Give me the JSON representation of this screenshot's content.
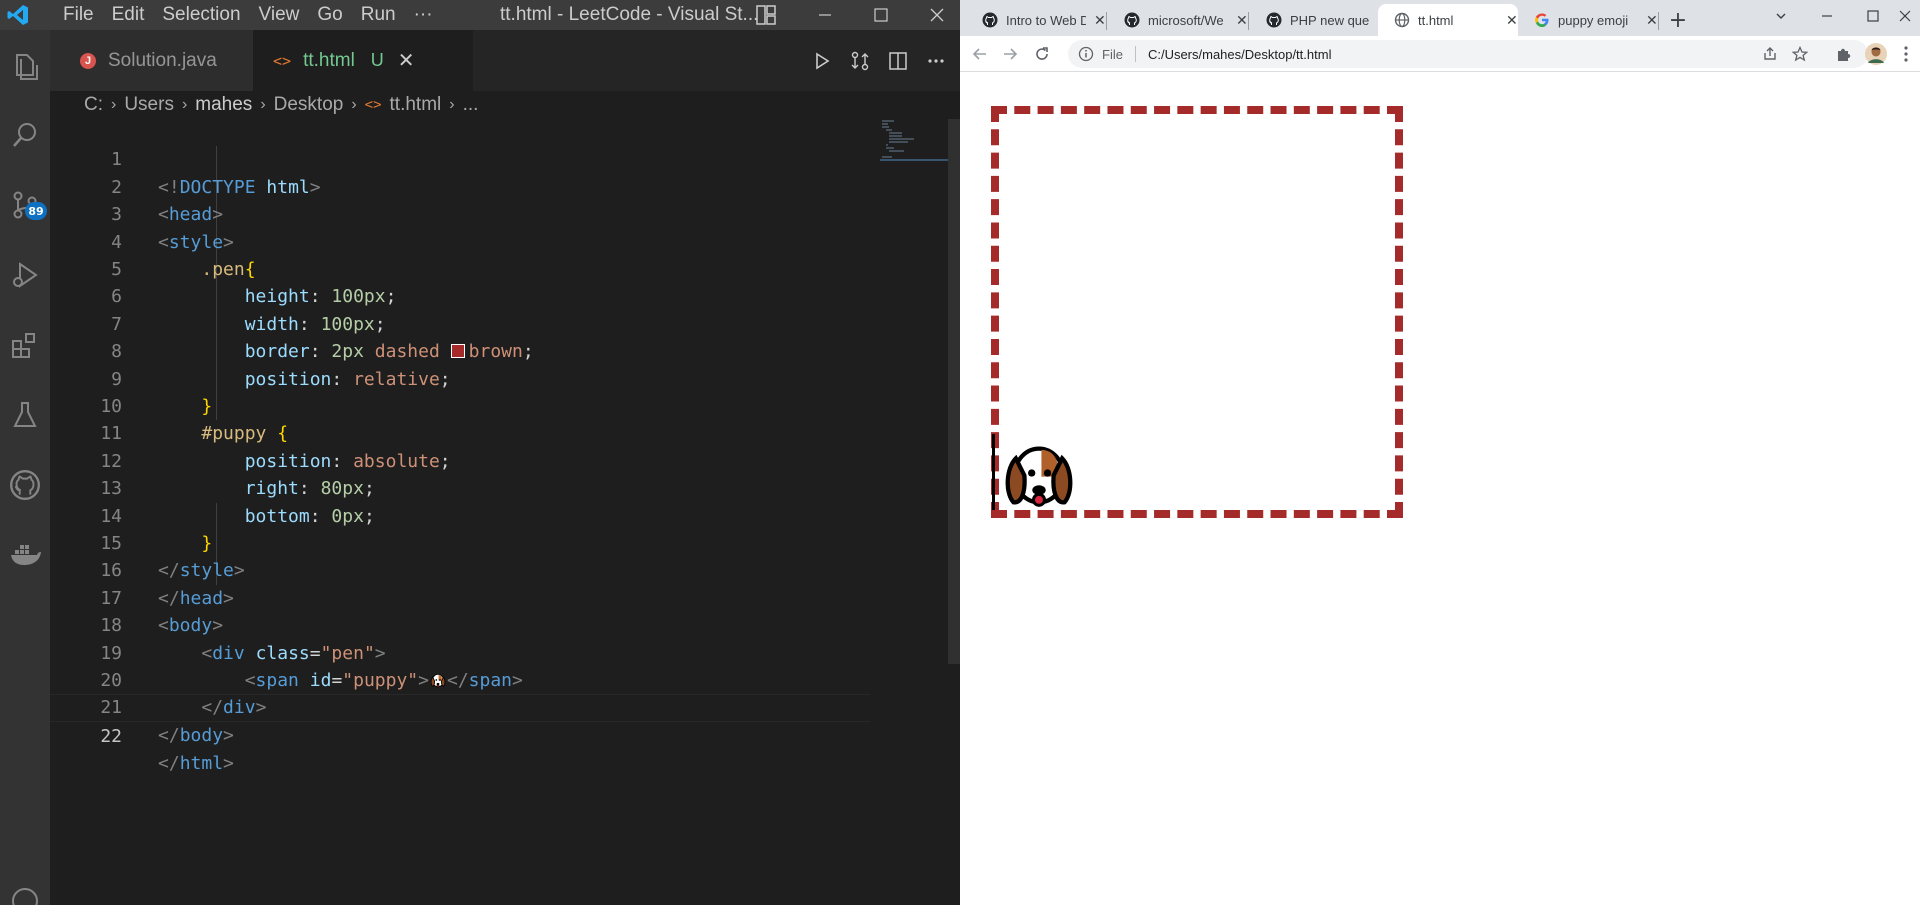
{
  "vscode": {
    "menu": [
      "File",
      "Edit",
      "Selection",
      "View",
      "Go",
      "Run",
      "···"
    ],
    "window_title": "tt.html - LeetCode - Visual St...",
    "scm_badge": "89",
    "tabs": [
      {
        "label": "Solution.java",
        "icon": "java-error-icon"
      },
      {
        "label": "tt.html",
        "icon": "html-icon",
        "status": "U"
      }
    ],
    "breadcrumb": [
      "C:",
      "Users",
      "mahes",
      "Desktop",
      "tt.html",
      "..."
    ],
    "line_numbers": [
      "1",
      "2",
      "3",
      "4",
      "5",
      "6",
      "7",
      "8",
      "9",
      "10",
      "11",
      "12",
      "13",
      "14",
      "15",
      "16",
      "17",
      "18",
      "19",
      "20",
      "21",
      "22"
    ],
    "code": {
      "doctype_open": "<!",
      "doctype_kw": "DOCTYPE",
      "doctype_name": "html",
      "head": "head",
      "style": "style",
      "pen_selector": ".pen",
      "height_prop": "height",
      "height_val": "100px",
      "width_prop": "width",
      "width_val": "100px",
      "border_prop": "border",
      "border_width": "2px",
      "border_style": "dashed",
      "border_color": "brown",
      "position_prop": "position",
      "position_relative": "relative",
      "puppy_selector": "#puppy",
      "position_absolute": "absolute",
      "right_prop": "right",
      "right_val": "80px",
      "bottom_prop": "bottom",
      "bottom_val": "0px",
      "body": "body",
      "div": "div",
      "class_attr": "class",
      "class_val": "\"pen\"",
      "span": "span",
      "id_attr": "id",
      "id_val": "\"puppy\"",
      "html": "html"
    },
    "colors": {
      "swatch": "#a52a2a",
      "accent": "#007acc"
    }
  },
  "chrome": {
    "tabs": [
      {
        "label": "Intro to Web D",
        "favicon": "github-icon"
      },
      {
        "label": "microsoft/We",
        "favicon": "github-icon"
      },
      {
        "label": "PHP new que",
        "favicon": "github-icon"
      },
      {
        "label": "tt.html",
        "favicon": "globe-icon",
        "active": true
      },
      {
        "label": "puppy emoji",
        "favicon": "google-icon"
      }
    ],
    "new_tab": "+",
    "omnibox_scheme": "File",
    "url": "C:/Users/mahes/Desktop/tt.html",
    "pen_border_color": "#a52a2a",
    "puppy_emoji": "dog-face-icon"
  }
}
